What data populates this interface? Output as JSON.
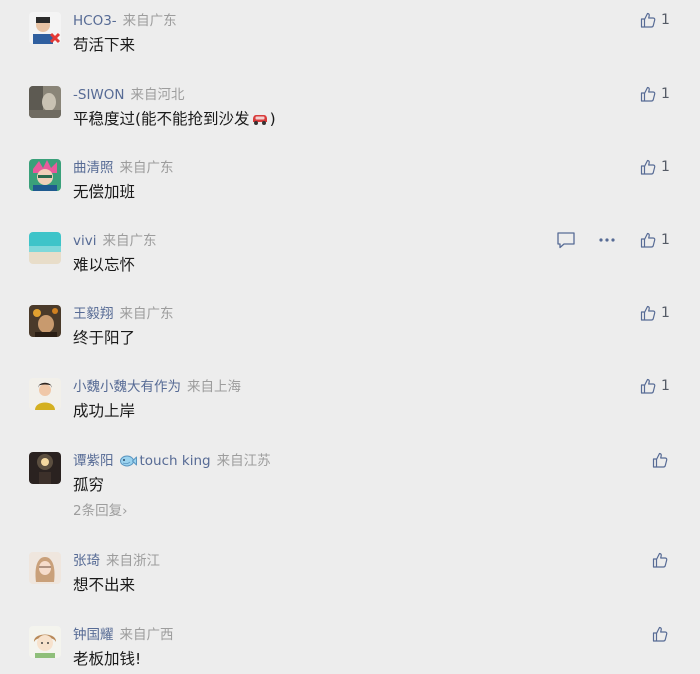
{
  "comments": [
    {
      "nick": "HCO3-",
      "location": "来自广东",
      "text": "苟活下来",
      "likes": "1"
    },
    {
      "nick": "-SIWON",
      "location": "来自河北",
      "text_before": "平稳度过(能不能抢到沙发",
      "text_emoji": "car-icon",
      "text_after": ")",
      "likes": "1"
    },
    {
      "nick": "曲清照",
      "location": "来自广东",
      "text": "无偿加班",
      "likes": "1"
    },
    {
      "nick": "vivi",
      "location": "来自广东",
      "text": "难以忘怀",
      "likes": "1"
    },
    {
      "nick": "王毅翔",
      "location": "来自广东",
      "text": "终于阳了",
      "likes": "1"
    },
    {
      "nick": "小魏小魏大有作为",
      "location": "来自上海",
      "text": "成功上岸",
      "likes": "1"
    },
    {
      "nick": "谭紫阳",
      "badge": "touch king",
      "location": "来自江苏",
      "text": "孤穷",
      "replies": "2条回复›"
    },
    {
      "nick": "张琦",
      "location": "来自浙江",
      "text": "想不出来"
    },
    {
      "nick": "钟国耀",
      "location": "来自广西",
      "text": "老板加钱!"
    }
  ]
}
